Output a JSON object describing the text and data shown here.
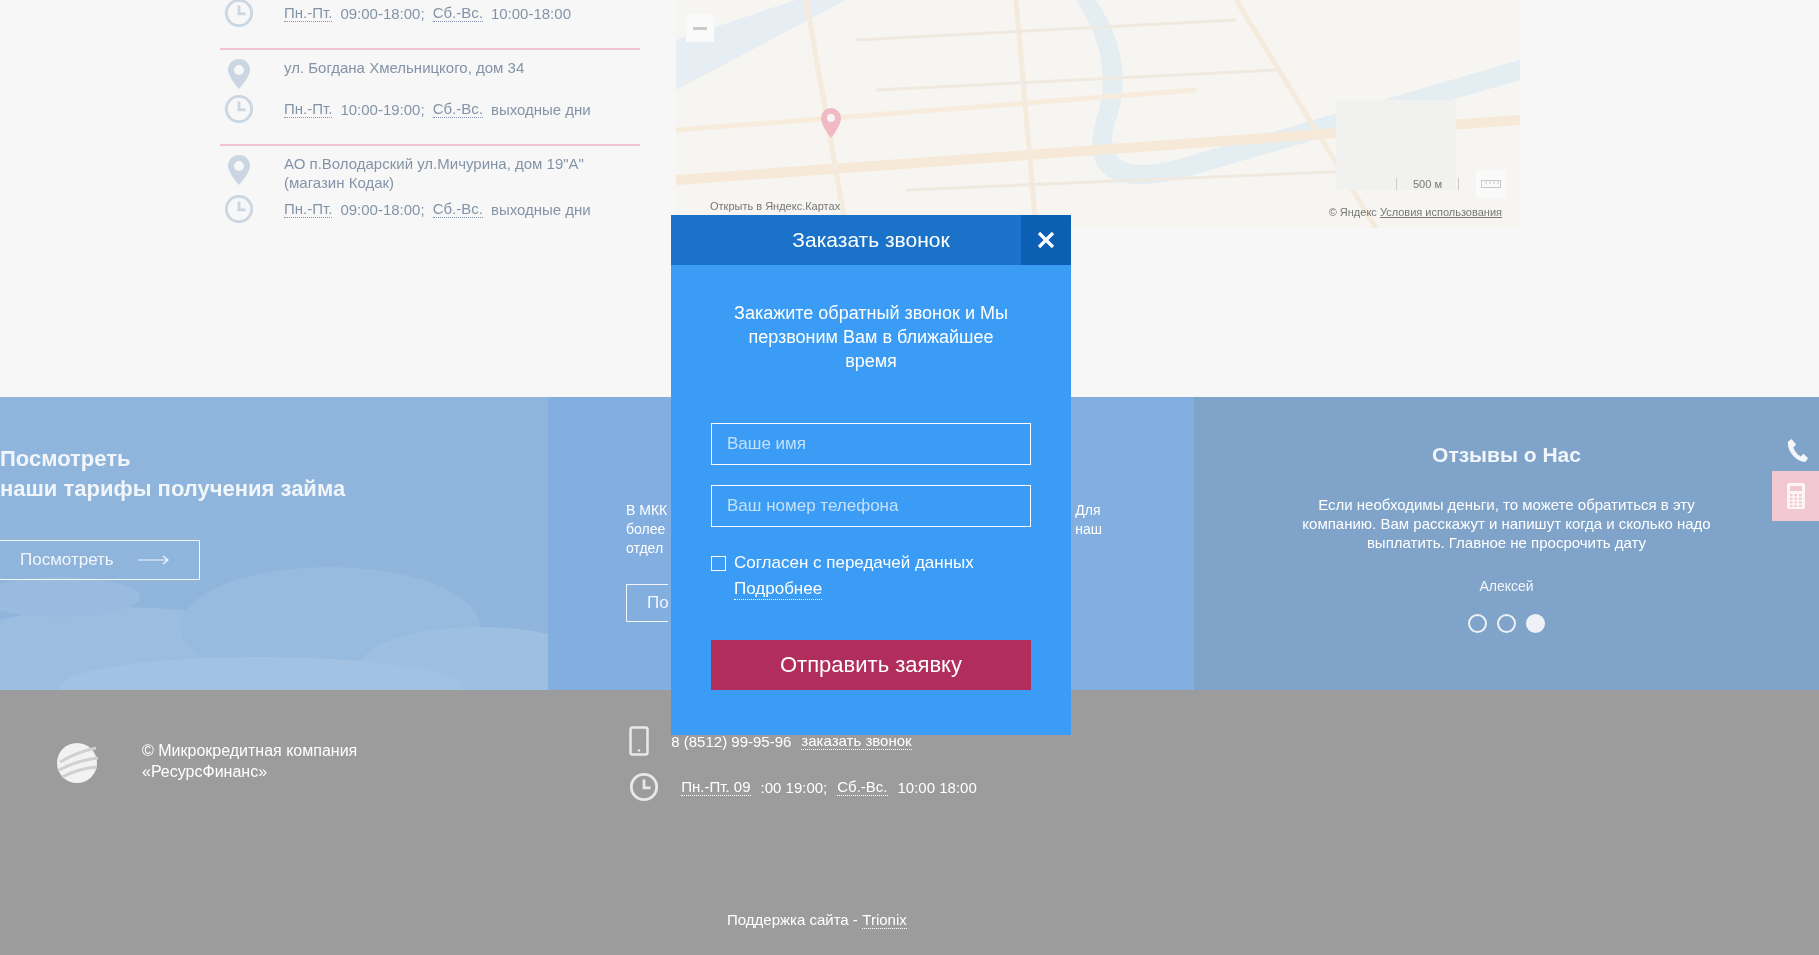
{
  "contacts": [
    {
      "kind": "hours",
      "days1": "Пн.-Пт.",
      "time1": "09:00-18:00;",
      "days2": "Сб.-Вс.",
      "time2": "10:00-18:00"
    },
    {
      "kind": "divider"
    },
    {
      "kind": "address",
      "lines": [
        "ул. Богдана Хмельницкого, дом 34"
      ]
    },
    {
      "kind": "hours",
      "days1": "Пн.-Пт.",
      "time1": "10:00-19:00;",
      "days2": "Сб.-Вс.",
      "time2": "выходные дни"
    },
    {
      "kind": "divider"
    },
    {
      "kind": "address",
      "lines": [
        "АО п.Володарский ул.Мичурина, дом 19\"А\"",
        "(магазин Кодак)"
      ]
    },
    {
      "kind": "hours",
      "days1": "Пн.-Пт.",
      "time1": "09:00-18:00;",
      "days2": "Сб.-Вс.",
      "time2": "выходные дни"
    }
  ],
  "map": {
    "kind": "picture",
    "open_link": "Открыть в Яндекс.Картах",
    "scale": "500 м",
    "copyright": "© Яндекс",
    "terms_link": "Условия использования"
  },
  "promo": {
    "title_lines": [
      "Посмотреть",
      "наши тарифы получения займа"
    ],
    "button": "Посмотреть"
  },
  "offers": {
    "left_lines": [
      "В МКК",
      "более",
      "отдел"
    ],
    "right_lines": [
      "Для",
      "наш"
    ],
    "button": "По"
  },
  "reviews": {
    "title": "Отзывы о Нас",
    "text": "Если необходимы деньги, то можете обратиться в эту компанию. Вам расскажут и напишут когда и сколько надо выплатить. Главное не просрочить дату",
    "author": "Алексей",
    "dots": [
      {
        "selected": false
      },
      {
        "selected": false
      },
      {
        "selected": true
      }
    ]
  },
  "modal": {
    "title": "Заказать звонок",
    "intro": "Закажите обратный звонок и Мы перзвоним Вам в ближайшее время",
    "fields": [
      {
        "placeholder": "Ваше имя"
      },
      {
        "placeholder": "Ваш номер телефона"
      }
    ],
    "consent": {
      "label": "Согласен с передачей данных",
      "checked": false,
      "link": "Подробнее"
    },
    "submit": "Отправить заявку"
  },
  "footer": {
    "company_lines": [
      "© Микрокредитная компания",
      "«РесурсФинанс»"
    ],
    "phone": "8 (8512) 99-95-96",
    "callback_link": "заказать звонок",
    "hours": [
      {
        "kind": "link",
        "text": "Пн.-Пт. 09"
      },
      {
        "kind": "text",
        "text": ":00 19:00;"
      },
      {
        "kind": "link",
        "text": "Сб.-Вс."
      },
      {
        "kind": "text",
        "text": "10:00 18:00"
      }
    ],
    "support": "Поддержка сайта -",
    "support_link": "Trionix"
  }
}
